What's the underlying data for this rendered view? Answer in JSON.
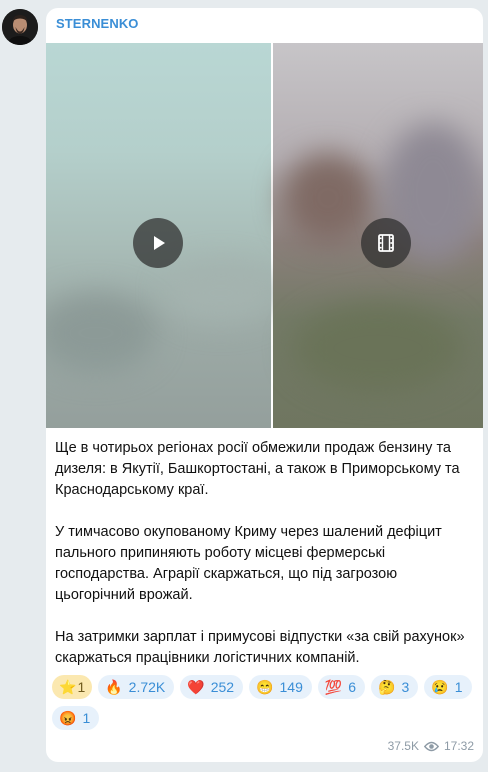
{
  "channel": {
    "name": "STERNENKO",
    "avatar_icon": "person-portrait-icon",
    "accent_color": "#3a8ed6"
  },
  "media": {
    "left_overlay_icon": "play-icon",
    "right_overlay_icon": "video-film-icon"
  },
  "message": {
    "paragraphs": [
      "Ще в чотирьох регіонах росії обмежили продаж бензину та дизеля: в Якутії, Башкортостані, а також в Приморському та Краснодарському краї.",
      "У тимчасово окупованому Криму через шалений дефіцит пального припиняють роботу місцеві фермерські господарства. Аграрії скаржаться, що під загрозою цьогорічний врожай.",
      "На затримки зарплат і примусові відпустки «за свій рахунок» скаржаться працівники логістичних компаній."
    ]
  },
  "reactions": [
    {
      "emoji": "⭐",
      "count": "1"
    },
    {
      "emoji": "🔥",
      "count": "2.72K"
    },
    {
      "emoji": "❤️",
      "count": "252"
    },
    {
      "emoji": "😁",
      "count": "149"
    },
    {
      "emoji": "💯",
      "count": "6"
    },
    {
      "emoji": "🤔",
      "count": "3"
    },
    {
      "emoji": "😢",
      "count": "1"
    },
    {
      "emoji": "😡",
      "count": "1"
    }
  ],
  "footer": {
    "views": "37.5K",
    "time": "17:32",
    "views_icon": "eye-icon"
  }
}
